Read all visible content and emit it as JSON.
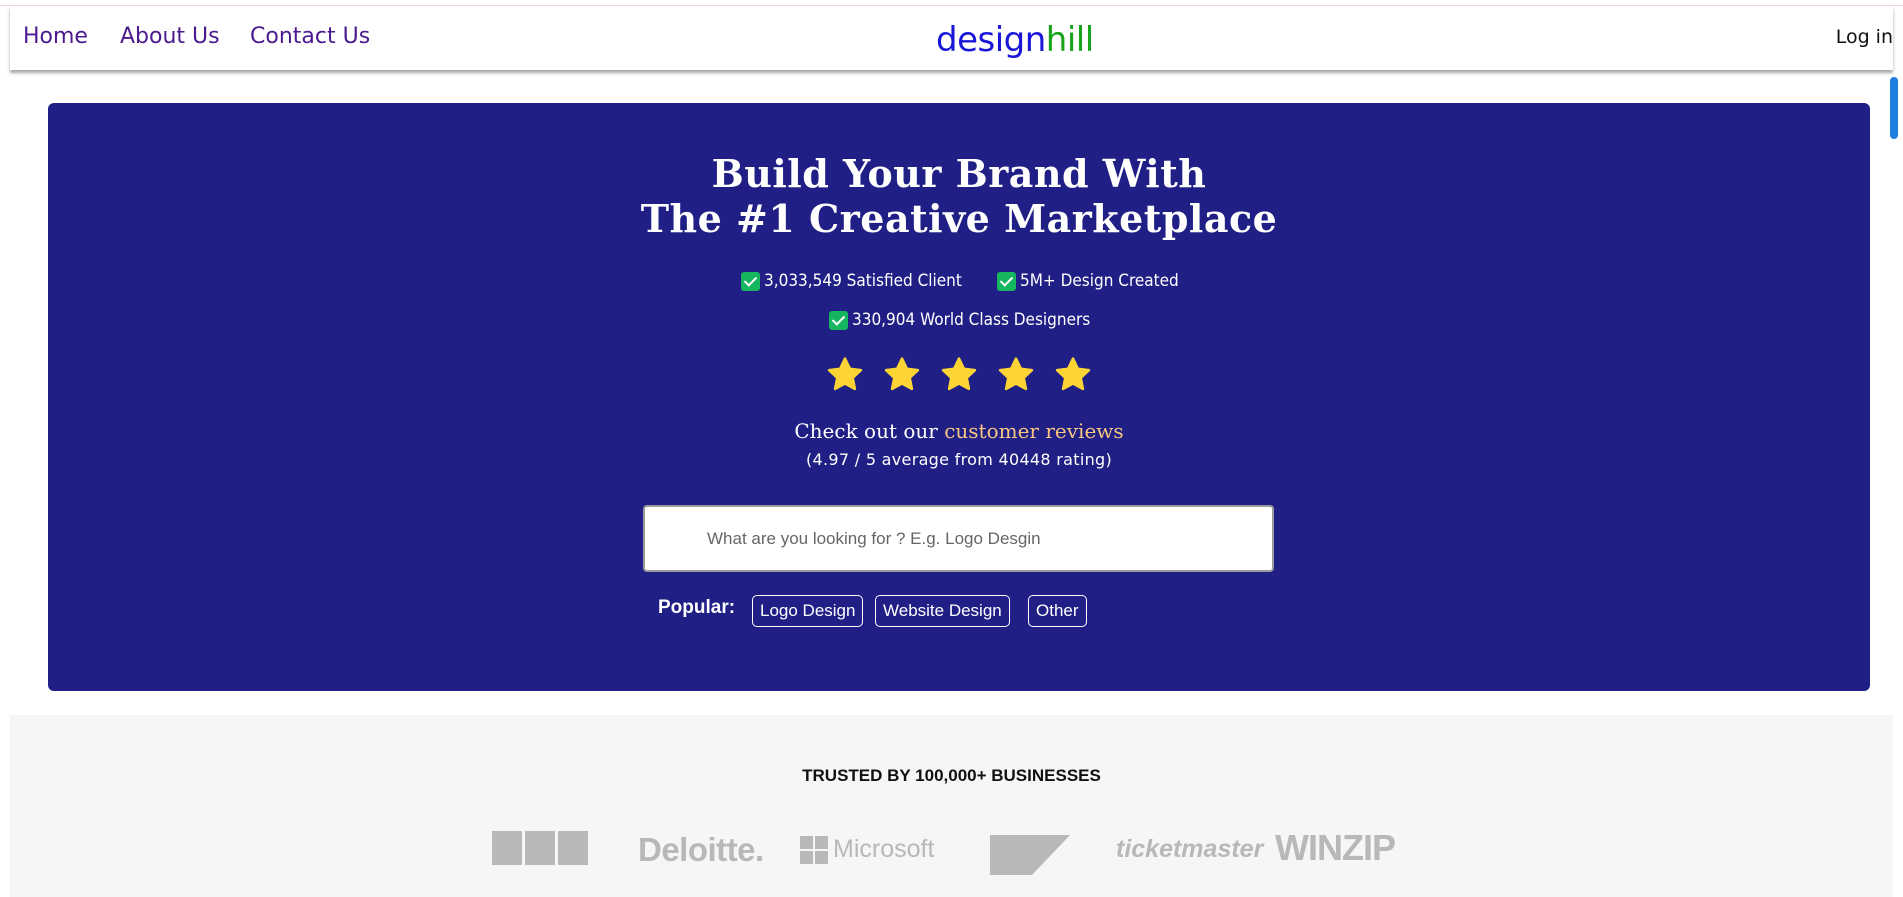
{
  "nav": {
    "links": [
      "Home",
      "About Us",
      "Contact Us"
    ],
    "logo_part1": "design",
    "logo_part2": "hill",
    "login": "Log in"
  },
  "hero": {
    "headline_line1": "Build Your Brand With",
    "headline_line2": "The #1 Creative Marketplace",
    "stats": [
      "3,033,549 Satisfied Client",
      "5M+ Design Created",
      "330,904 World Class Designers"
    ],
    "rating_stars": 5,
    "reviews_prefix": "Check out our",
    "reviews_link": "customer reviews",
    "rating_summary": "(4.97 / 5 average from 40448 rating)",
    "search_placeholder": "What are you looking for ? E.g. Logo Desgin",
    "popular_label": "Popular:",
    "popular_tags": [
      "Logo Design",
      "Website Design",
      "Other"
    ]
  },
  "trusted": {
    "title": "TRUSTED BY 100,000+ BUSINESSES",
    "brands": [
      "BBC",
      "Deloitte.",
      "Microsoft",
      "SAP",
      "ticketmaster",
      "WINZIP"
    ]
  },
  "colors": {
    "hero_bg": "#201f85",
    "logo_blue": "#1a16d8",
    "logo_green": "#17a31c",
    "nav_link": "#4b1a8f",
    "review_link": "#f7c680",
    "check_green": "#16b55f",
    "star_yellow": "#fcd535"
  }
}
